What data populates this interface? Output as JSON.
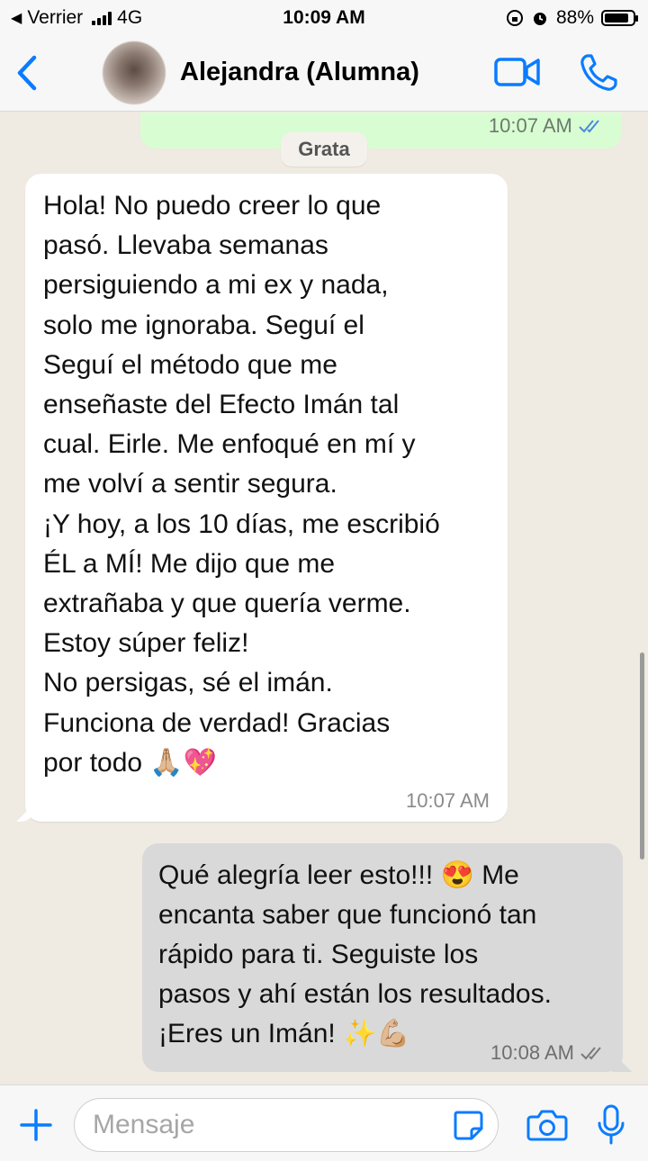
{
  "status_bar": {
    "carrier": "Verrier",
    "network": "4G",
    "time": "10:09 AM",
    "battery": "88%",
    "battery_level": 0.88
  },
  "header": {
    "contact_name": "Alejandra (Alumna)"
  },
  "chat": {
    "previous_sent_time": "10:07 AM",
    "date_chip": "Grata",
    "incoming": {
      "text": "Hola! No puedo creer lo que\npasó. Llevaba semanas\npersiguiendo a mi ex y nada,\nsolo me ignoraba. Seguí el\nSeguí el método que me\nenseñaste del Efecto Imán tal\ncual. Eirle. Me enfoqué en mí y\nme volví a sentir segura.\n¡Y hoy, a los 10 días, me escribió\nÉL a MÍ! Me dijo que me\nextrañaba y que quería verme.\nEstoy súper feliz!\nNo persigas, sé el imán.\nFunciona de verdad! Gracias\npor todo 🙏🏼💖",
      "time": "10:07 AM"
    },
    "outgoing": {
      "text": "Qué alegría leer esto!!! 😍 Me\nencanta saber que funcionó tan\nrápido para ti. Seguiste los\npasos y ahí están los resultados.\n¡Eres un Imán! ✨💪🏼",
      "time": "10:08 AM"
    }
  },
  "input": {
    "placeholder": "Mensaje"
  },
  "colors": {
    "accent": "#0a7cff",
    "chat_background": "#efeae2",
    "incoming_bubble": "#ffffff",
    "outgoing_bubble": "#d9d9d9",
    "sent_top_bubble": "#d9fdd3"
  }
}
